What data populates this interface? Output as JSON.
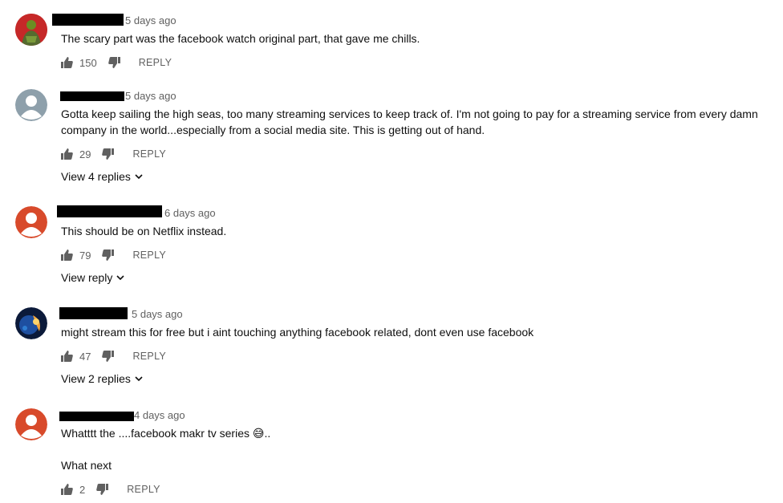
{
  "comments": [
    {
      "time": "5 days ago",
      "text": "The scary part was the facebook watch original part, that gave me chills.",
      "likes": "150",
      "reply_label": "REPLY",
      "avatar": "green-character-avatar"
    },
    {
      "time": "5 days ago",
      "text_line1": "Gotta keep sailing the high seas, too many streaming services to keep track of. I'm not going to  pay for a streaming service from every damn",
      "text_line2": "company in the world...especially from a social media site. This is getting out of hand.",
      "likes": "29",
      "reply_label": "REPLY",
      "view_replies": "View 4 replies",
      "avatar": "gray-default-avatar"
    },
    {
      "time": "6 days ago",
      "text": "This should be on Netflix instead.",
      "likes": "79",
      "reply_label": "REPLY",
      "view_replies": "View reply",
      "avatar": "red-default-avatar"
    },
    {
      "time": "5 days ago",
      "text": "might stream this for free but i aint touching anything facebook related, dont even use facebook",
      "likes": "47",
      "reply_label": "REPLY",
      "view_replies": "View 2 replies",
      "avatar": "earth-space-avatar"
    },
    {
      "time": "4 days ago",
      "text_line1": "Whatttt the ....facebook makr tv series 😅..",
      "text_line2": "What next",
      "likes": "2",
      "reply_label": "REPLY",
      "avatar": "red-default-avatar"
    }
  ],
  "colors": {
    "meta": "#606060",
    "text": "#0f0f0f",
    "avatar_red": "#d84a2b",
    "avatar_gray": "#8ea0ab"
  }
}
